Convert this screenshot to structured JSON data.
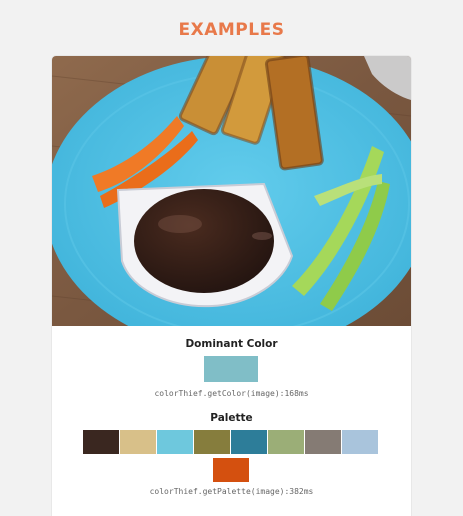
{
  "header": {
    "title": "EXAMPLES"
  },
  "example": {
    "dominant_title": "Dominant Color",
    "dominant_color": "#80bec7",
    "dominant_code": "colorThief.getColor(image):168ms",
    "palette_title": "Palette",
    "palette": [
      "#3a2720",
      "#d8c089",
      "#6ec8dd",
      "#867d3d",
      "#2d7d99",
      "#9bae77",
      "#857b74",
      "#a9c4dc"
    ],
    "palette_extra": "#d4500f",
    "palette_code": "colorThief.getPalette(image):382ms"
  }
}
